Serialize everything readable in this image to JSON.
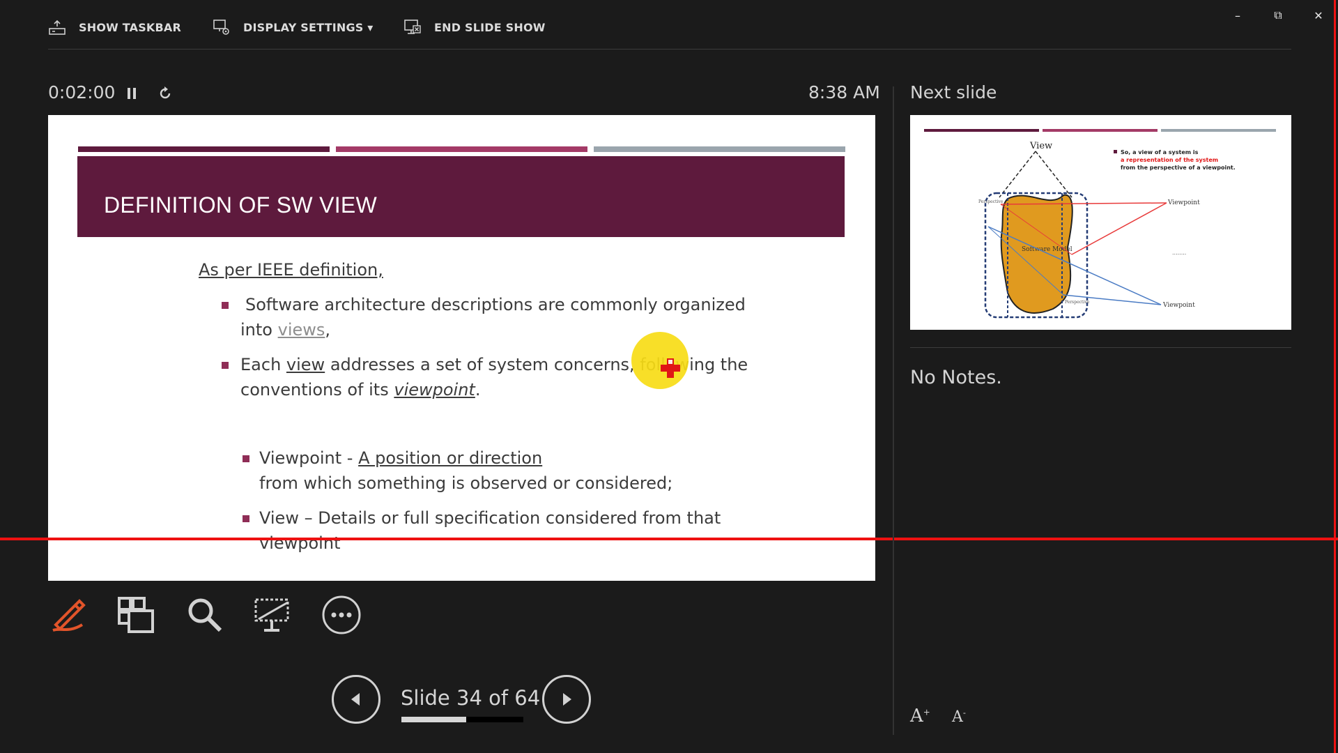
{
  "toolbar": {
    "show_taskbar": "SHOW TASKBAR",
    "display_settings": "DISPLAY SETTINGS ▾",
    "end_slide_show": "END SLIDE SHOW"
  },
  "window": {
    "minimize": "–",
    "restore": "⧉",
    "close": "✕"
  },
  "presenter": {
    "timer": "0:02:00",
    "clock": "8:38 AM",
    "slide_counter": "Slide 34 of 64",
    "progress_fraction": 0.53,
    "next_slide_label": "Next slide",
    "notes": "No Notes."
  },
  "slide": {
    "title": "DEFINITION OF SW VIEW",
    "bar_colors": [
      "#5e1a3d",
      "#a33a66",
      "#9aa5ad"
    ],
    "line_heading": "As per IEEE definition,",
    "b1_line1": "Software architecture descriptions are commonly organized",
    "b1_into": "into",
    "b1_views": "views",
    "b1_comma": ",",
    "b2_each": "Each",
    "b2_view": "view",
    "b2_rest": "addresses a set of system concerns, following the",
    "b2_line2_pre": "conventions of its",
    "b2_viewpoint": "viewpoint",
    "b2_period": ".",
    "s1_label": "Viewpoint  -",
    "s1_link": "A position or direction",
    "s1_line2": "from  which something is observed or considered;",
    "s2_line1": "View – Details or full specification considered from that",
    "s2_line2": "viewpoint"
  },
  "next_slide": {
    "label_view": "View",
    "label_viewpoint_top": "Viewpoint",
    "label_viewpoint_bottom": "Viewpoint",
    "label_model": "Software\nModel",
    "label_perspective_top": "Perspective",
    "label_perspective_bottom": "Perspective",
    "label_dots": "........",
    "bullet_text_1": "So, a view of a system is",
    "bullet_text_red": "a representation of the system",
    "bullet_text_2": "from the perspective of a viewpoint."
  },
  "colors": {
    "accent_red": "#ee1111",
    "slide_title_band": "#5e1a3d",
    "bullet": "#8f2d56",
    "pen_icon": "#e2542a",
    "pointer_yellow": "#f7dc16"
  }
}
